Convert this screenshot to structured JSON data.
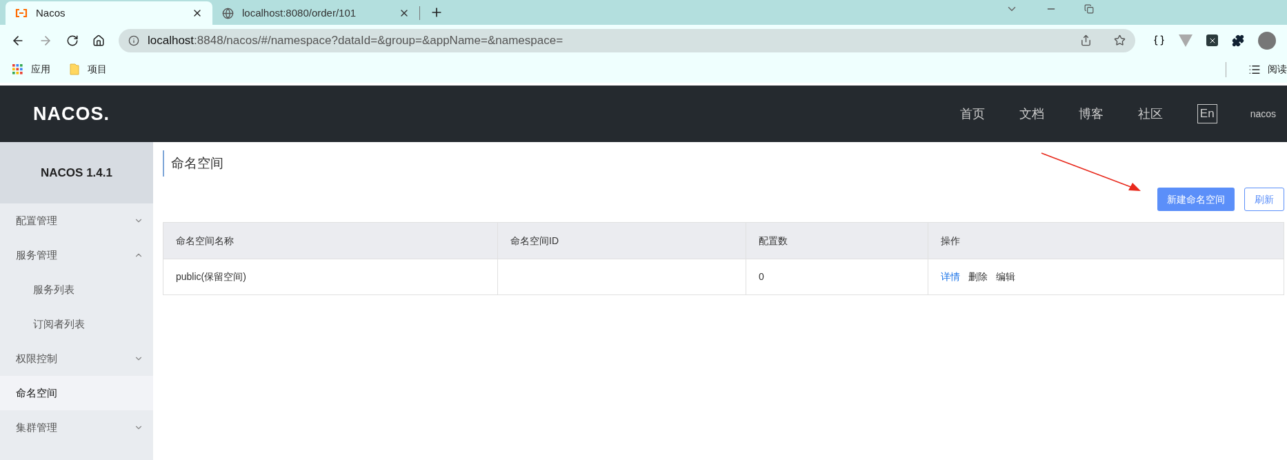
{
  "browser": {
    "tabs": [
      {
        "title": "Nacos",
        "selected": true
      },
      {
        "title": "localhost:8080/order/101",
        "selected": false
      }
    ],
    "address": {
      "host": "localhost",
      "rest": ":8848/nacos/#/namespace?dataId=&group=&appName=&namespace="
    },
    "bookmarks": [
      {
        "label": "应用",
        "kind": "apps"
      },
      {
        "label": "项目",
        "kind": "folder"
      }
    ],
    "reading_list": "阅读"
  },
  "header": {
    "logo": "NACOS.",
    "nav": [
      "首页",
      "文档",
      "博客",
      "社区"
    ],
    "language": "En",
    "user": "nacos"
  },
  "sidebar": {
    "version": "NACOS 1.4.1",
    "items": [
      {
        "label": "配置管理",
        "selected": false,
        "expanded": false
      },
      {
        "label": "服务管理",
        "selected": false,
        "expanded": true,
        "children": [
          {
            "label": "服务列表",
            "selected": false
          },
          {
            "label": "订阅者列表",
            "selected": false
          }
        ]
      },
      {
        "label": "权限控制",
        "selected": false,
        "expanded": false
      },
      {
        "label": "命名空间",
        "selected": true
      },
      {
        "label": "集群管理",
        "selected": false,
        "expanded": false
      }
    ]
  },
  "page": {
    "title": "命名空间",
    "buttons": [
      {
        "label": "新建命名空间",
        "kind": "primary"
      },
      {
        "label": "刷新",
        "kind": "secondary"
      }
    ],
    "table": {
      "columns": [
        "命名空间名称",
        "命名空间ID",
        "配置数",
        "操作"
      ],
      "rows": [
        {
          "name": "public(保留空间)",
          "count": "0",
          "actions": [
            {
              "label": "详情",
              "kind": "link"
            },
            {
              "label": "删除",
              "kind": "plain"
            },
            {
              "label": "编辑",
              "kind": "plain"
            }
          ]
        }
      ]
    }
  }
}
